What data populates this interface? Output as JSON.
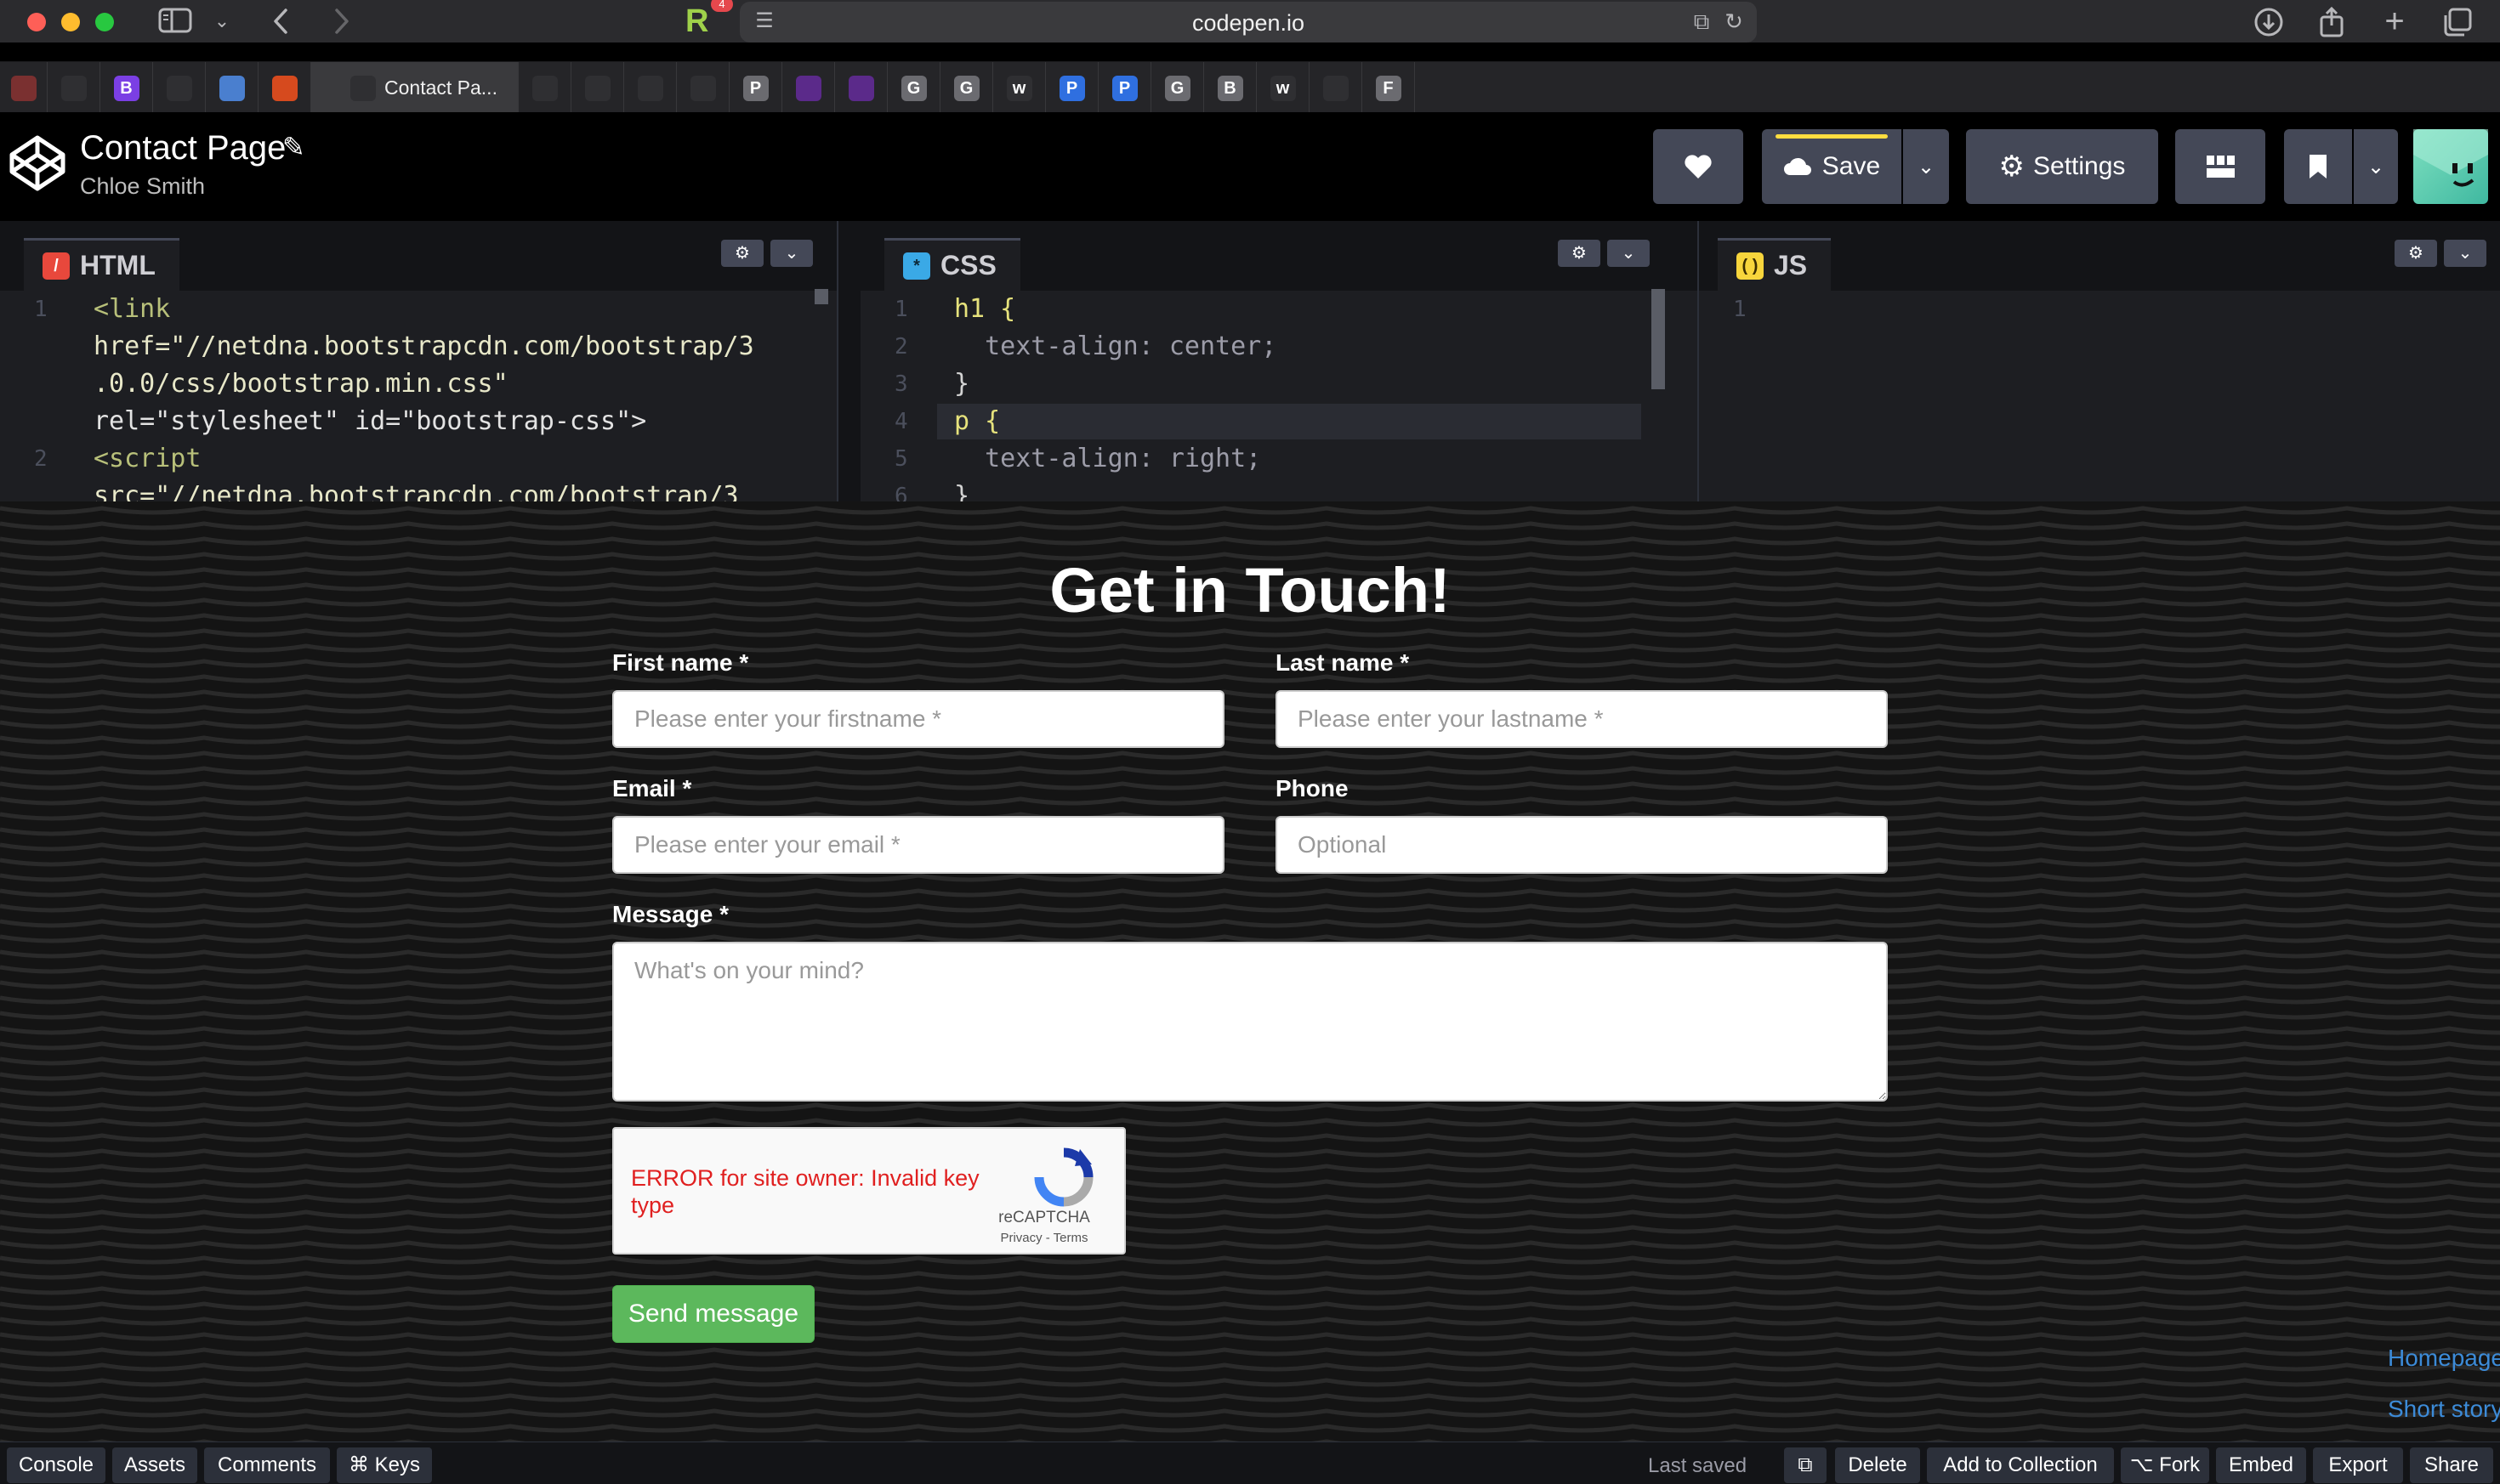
{
  "browser": {
    "url": "codepen.io",
    "reader_badge": "4",
    "active_tab_label": "Contact Pa...",
    "tabs": [
      {
        "icon": "pen-icon",
        "letter": "",
        "color": "#7a3030"
      },
      {
        "icon": "drive-icon",
        "letter": "",
        "color": "#2f2f32"
      },
      {
        "icon": "bootstrap-icon",
        "letter": "B",
        "color": "#7b3fe4"
      },
      {
        "icon": "github-icon",
        "letter": "",
        "color": "#2f2f32"
      },
      {
        "icon": "wave-icon",
        "letter": "",
        "color": "#4a7fcf"
      },
      {
        "icon": "brave-icon",
        "letter": "",
        "color": "#d64a1e"
      },
      {
        "icon": "codepen-icon",
        "letter": "",
        "color": "#2f2f32"
      },
      {
        "icon": "github-icon",
        "letter": "",
        "color": "#2f2f32"
      },
      {
        "icon": "github-icon",
        "letter": "",
        "color": "#2f2f32"
      },
      {
        "icon": "github-icon",
        "letter": "",
        "color": "#2f2f32"
      },
      {
        "icon": "github-icon",
        "letter": "",
        "color": "#2f2f32"
      },
      {
        "icon": "letter-p-icon",
        "letter": "P",
        "color": "#6b6b70"
      },
      {
        "icon": "crown-icon",
        "letter": "",
        "color": "#5b2a8a"
      },
      {
        "icon": "crown-icon",
        "letter": "",
        "color": "#5b2a8a"
      },
      {
        "icon": "letter-g-icon",
        "letter": "G",
        "color": "#6b6b70"
      },
      {
        "icon": "letter-g-icon",
        "letter": "G",
        "color": "#6b6b70"
      },
      {
        "icon": "w3-icon",
        "letter": "w",
        "color": "#2f2f32"
      },
      {
        "icon": "letter-p-blue-icon",
        "letter": "P",
        "color": "#2f6fe0"
      },
      {
        "icon": "letter-p-blue-icon",
        "letter": "P",
        "color": "#2f6fe0"
      },
      {
        "icon": "letter-g-icon",
        "letter": "G",
        "color": "#6b6b70"
      },
      {
        "icon": "letter-b-icon",
        "letter": "B",
        "color": "#6b6b70"
      },
      {
        "icon": "w3-icon",
        "letter": "w",
        "color": "#2f2f32"
      },
      {
        "icon": "brackets-icon",
        "letter": "",
        "color": "#2f2f32"
      },
      {
        "icon": "letter-f-icon",
        "letter": "F",
        "color": "#6b6b70"
      }
    ]
  },
  "header": {
    "title": "Contact Page",
    "author": "Chloe Smith",
    "save_label": "Save",
    "settings_label": "Settings"
  },
  "editors": {
    "html": {
      "name": "HTML",
      "lines": [
        {
          "num": "1",
          "text": "<link"
        },
        {
          "num": "",
          "text": "href=\"//netdna.bootstrapcdn.com/bootstrap/3"
        },
        {
          "num": "",
          "text": ".0.0/css/bootstrap.min.css\""
        },
        {
          "num": "",
          "text": "rel=\"stylesheet\" id=\"bootstrap-css\">"
        },
        {
          "num": "2",
          "text": "<script"
        },
        {
          "num": "",
          "text": "src=\"//netdna.bootstrapcdn.com/bootstrap/3"
        }
      ]
    },
    "css": {
      "name": "CSS",
      "lines": [
        {
          "num": "1",
          "text": "h1 {"
        },
        {
          "num": "2",
          "text": "  text-align: center;"
        },
        {
          "num": "3",
          "text": "}"
        },
        {
          "num": "4",
          "text": "p {"
        },
        {
          "num": "5",
          "text": "  text-align: right;"
        },
        {
          "num": "6",
          "text": "}"
        }
      ]
    },
    "js": {
      "name": "JS",
      "lines": [
        {
          "num": "1",
          "text": ""
        }
      ]
    }
  },
  "preview": {
    "title": "Get in Touch!",
    "form": {
      "first_name_label": "First name *",
      "first_name_placeholder": "Please enter your firstname *",
      "last_name_label": "Last name *",
      "last_name_placeholder": "Please enter your lastname *",
      "email_label": "Email *",
      "email_placeholder": "Please enter your email *",
      "phone_label": "Phone",
      "phone_placeholder": "Optional",
      "message_label": "Message *",
      "message_placeholder": "What's on your mind?",
      "send_label": "Send message"
    },
    "recaptcha": {
      "error": "ERROR for site owner: Invalid key type",
      "brand": "reCAPTCHA",
      "links": "Privacy - Terms"
    },
    "side_links": [
      "Homepage",
      "Short story"
    ]
  },
  "footer": {
    "console": "Console",
    "assets": "Assets",
    "comments": "Comments",
    "keys": "⌘ Keys",
    "last_saved": "Last saved",
    "delete": "Delete",
    "add_to_collection": "Add to Collection",
    "fork": "⌥ Fork",
    "embed": "Embed",
    "export": "Export",
    "share": "Share"
  },
  "colors": {
    "accent_save": "#ffdd40",
    "send_button": "#5cb85c",
    "recaptcha_error": "#e02020",
    "link": "#3c8bd8"
  }
}
